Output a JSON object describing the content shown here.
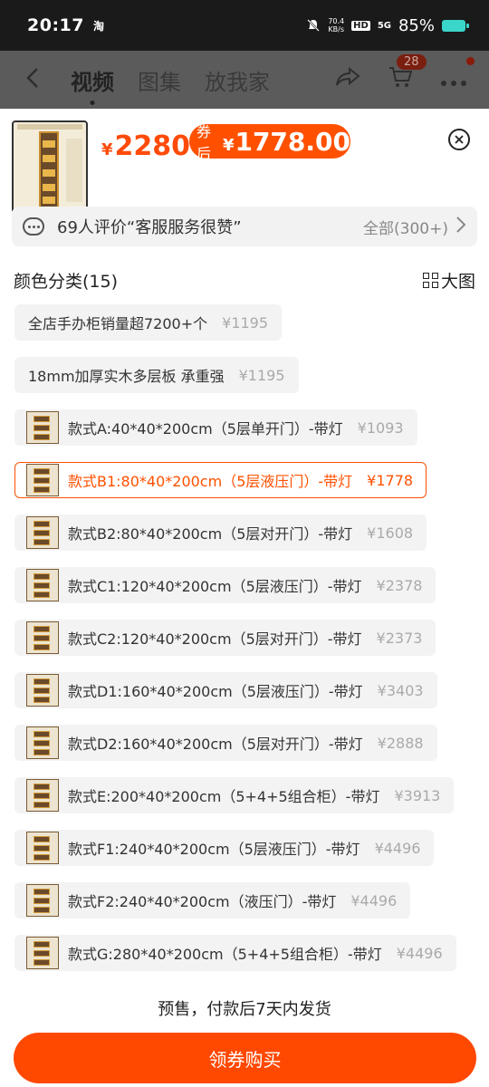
{
  "status": {
    "time": "20:17",
    "app_glyph": "淘",
    "speed": "70.4",
    "speed_unit": "KB/s",
    "hd": "HD",
    "network": "5G",
    "battery": "85%"
  },
  "nav": {
    "tabs": [
      "视频",
      "图集",
      "放我家"
    ],
    "cart_count": "28"
  },
  "product": {
    "price": "2280",
    "coupon_label": "券后",
    "coupon_price": "1778.00",
    "currency": "¥"
  },
  "review": {
    "text": "69人评价“客服服务很赞”",
    "all": "全部(300+)"
  },
  "section": {
    "title": "颜色分类(15)",
    "big_pic": "大图"
  },
  "options": [
    {
      "label": "全店手办柜销量超7200+个",
      "price": "¥1195",
      "image": false,
      "selected": false
    },
    {
      "label": "18mm加厚实木多层板  承重强",
      "price": "¥1195",
      "image": false,
      "selected": false
    },
    {
      "label": "款式A:40*40*200cm（5层单开门）-带灯",
      "price": "¥1093",
      "image": true,
      "selected": false
    },
    {
      "label": "款式B1:80*40*200cm（5层液压门）-带灯",
      "price": "¥1778",
      "image": true,
      "selected": true
    },
    {
      "label": "款式B2:80*40*200cm（5层对开门）-带灯",
      "price": "¥1608",
      "image": true,
      "selected": false
    },
    {
      "label": "款式C1:120*40*200cm（5层液压门）-带灯",
      "price": "¥2378",
      "image": true,
      "selected": false
    },
    {
      "label": "款式C2:120*40*200cm（5层对开门）-带灯",
      "price": "¥2373",
      "image": true,
      "selected": false
    },
    {
      "label": "款式D1:160*40*200cm（5层液压门）-带灯",
      "price": "¥3403",
      "image": true,
      "selected": false
    },
    {
      "label": "款式D2:160*40*200cm（5层对开门）-带灯",
      "price": "¥2888",
      "image": true,
      "selected": false
    },
    {
      "label": "款式E:200*40*200cm（5+4+5组合柜）-带灯",
      "price": "¥3913",
      "image": true,
      "selected": false
    },
    {
      "label": "款式F1:240*40*200cm（5层液压门）-带灯",
      "price": "¥4496",
      "image": true,
      "selected": false
    },
    {
      "label": "款式F2:240*40*200cm（液压门）-带灯",
      "price": "¥4496",
      "image": true,
      "selected": false
    },
    {
      "label": "款式G:280*40*200cm（5+4+5组合柜）-带灯",
      "price": "¥4496",
      "image": true,
      "selected": false
    }
  ],
  "footer": {
    "ship_note": "预售，付款后7天内发货",
    "buy_label": "领券购买"
  }
}
